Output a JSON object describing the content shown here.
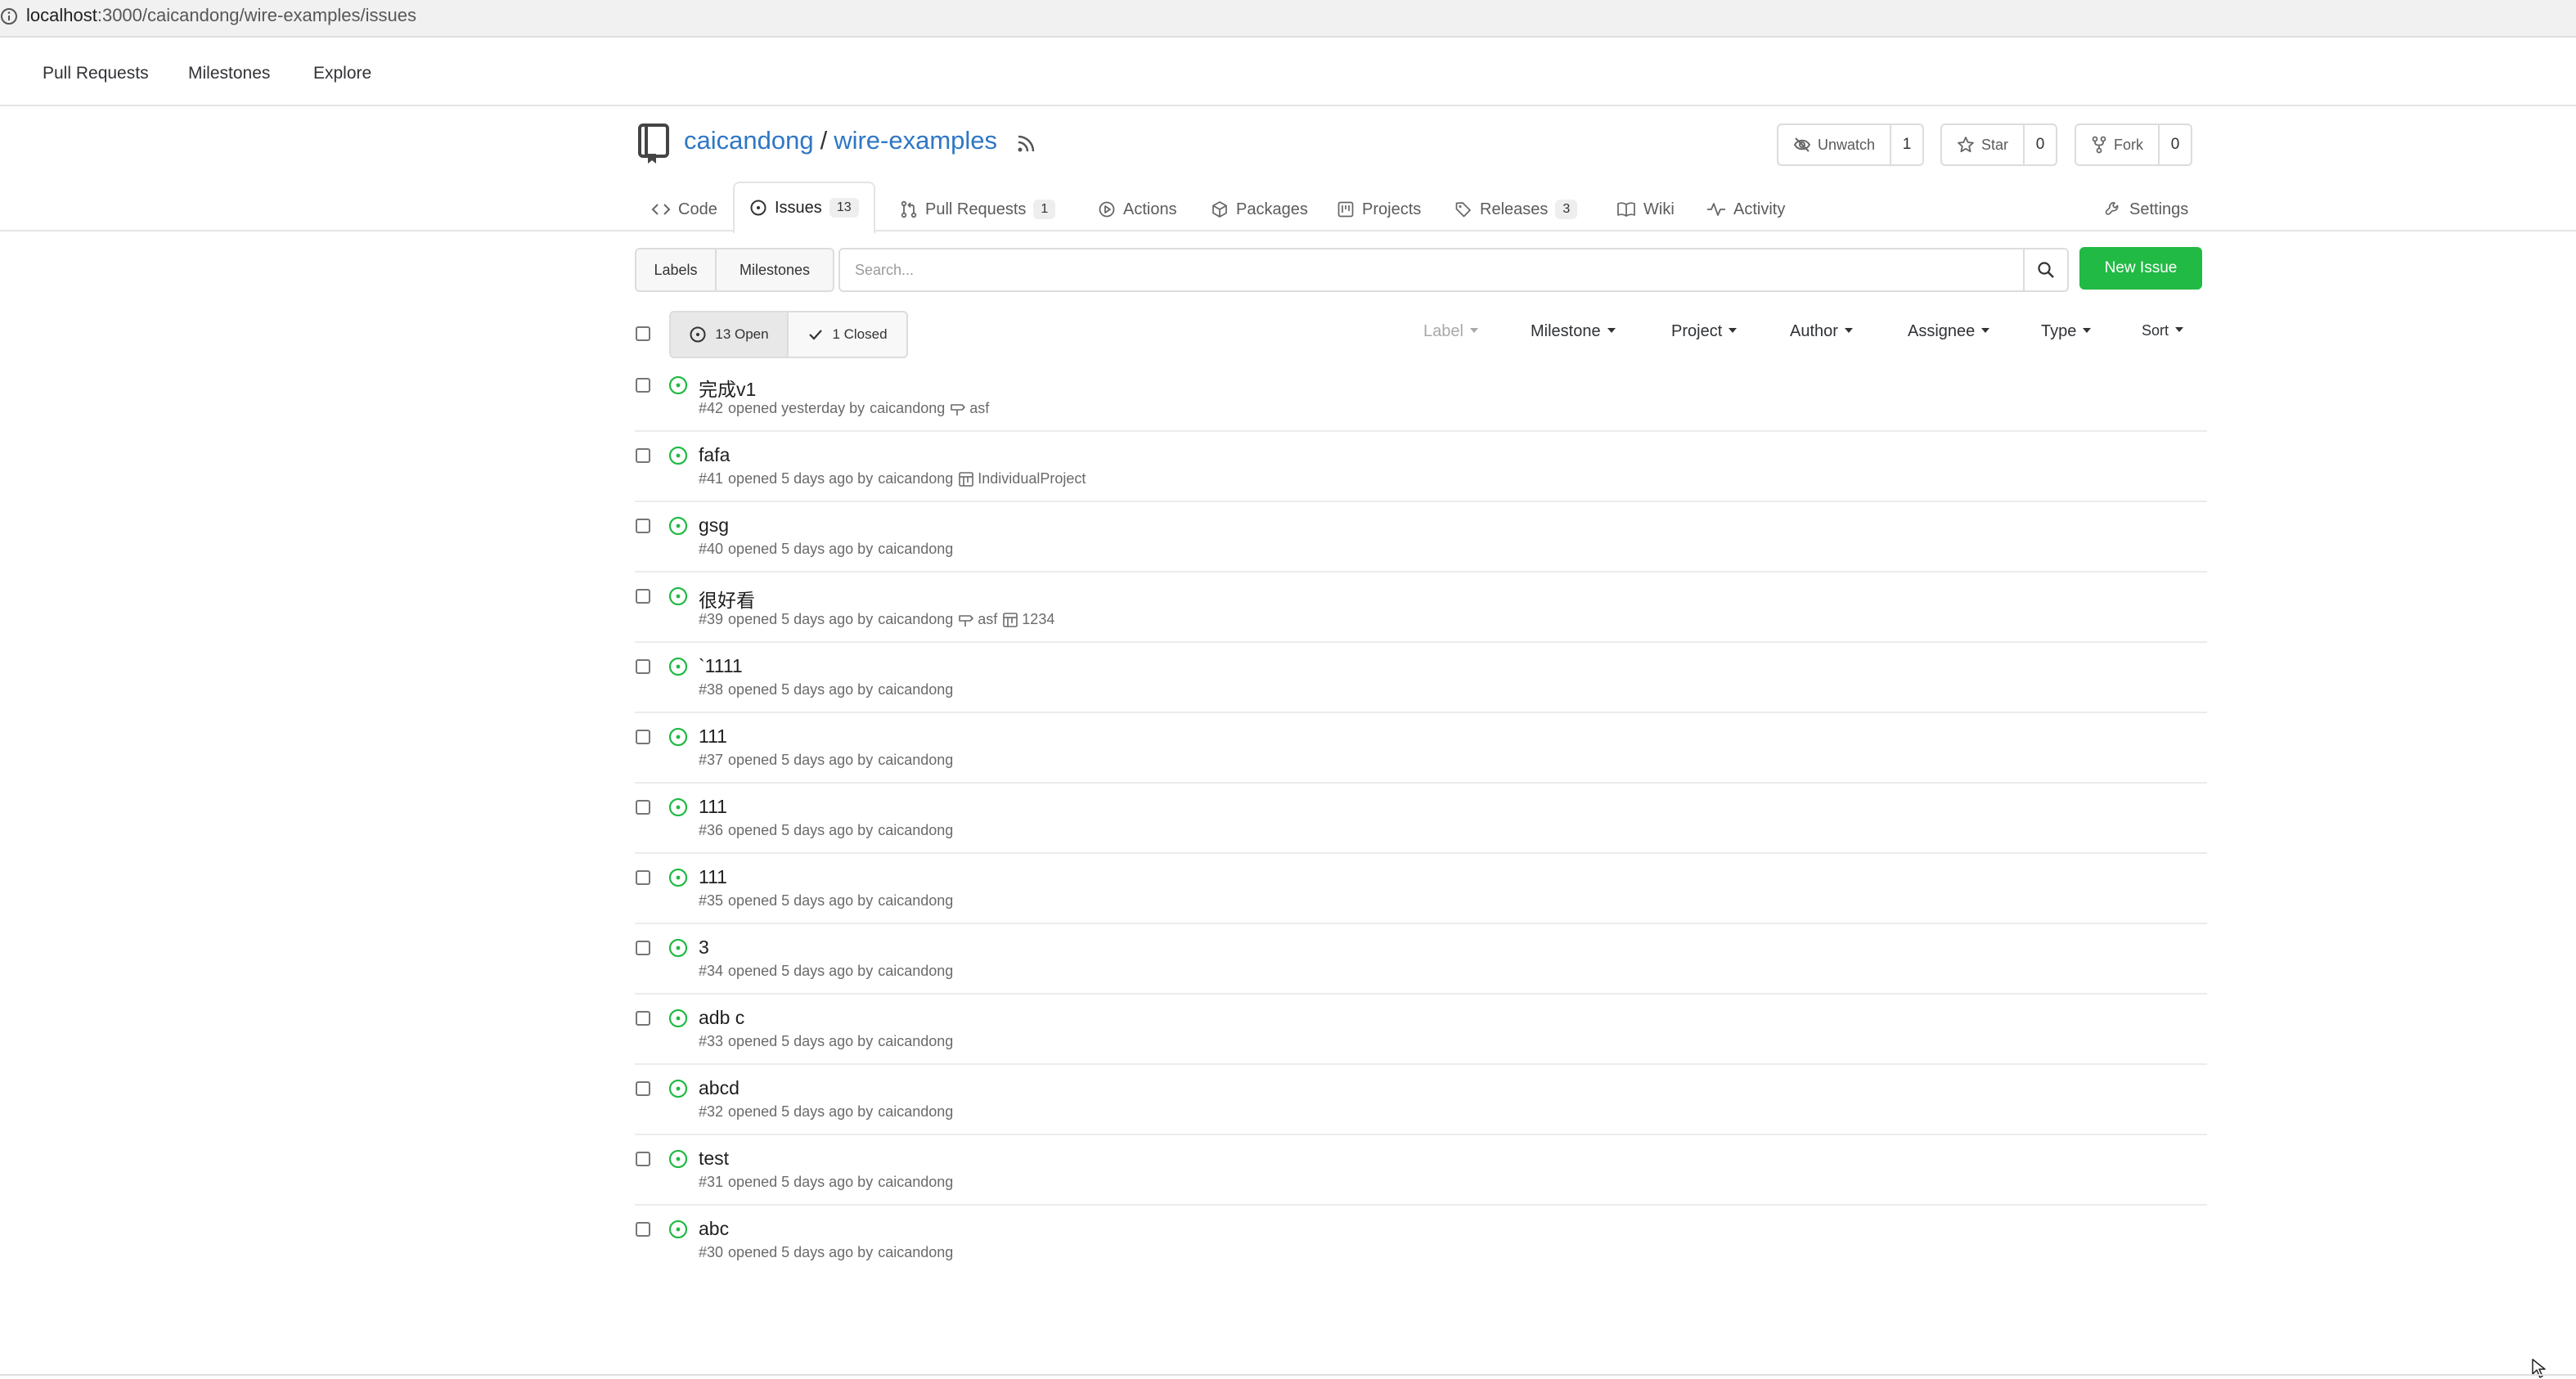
{
  "browser": {
    "url_host": "localhost",
    "url_path": ":3000/caicandong/wire-examples/issues"
  },
  "topnav": {
    "items": [
      "Pull Requests",
      "Milestones",
      "Explore"
    ]
  },
  "repo": {
    "owner": "caicandong",
    "separator": "/",
    "name": "wire-examples",
    "watch": {
      "label": "Unwatch",
      "count": "1"
    },
    "star": {
      "label": "Star",
      "count": "0"
    },
    "fork": {
      "label": "Fork",
      "count": "0"
    }
  },
  "tabs": {
    "code": "Code",
    "issues": {
      "label": "Issues",
      "count": "13"
    },
    "pulls": {
      "label": "Pull Requests",
      "count": "1"
    },
    "actions": "Actions",
    "packages": "Packages",
    "projects": "Projects",
    "releases": {
      "label": "Releases",
      "count": "3"
    },
    "wiki": "Wiki",
    "activity": "Activity",
    "settings": "Settings"
  },
  "filterbar": {
    "labels": "Labels",
    "milestones": "Milestones",
    "search_placeholder": "Search...",
    "new_issue": "New Issue"
  },
  "list_header": {
    "open": "13 Open",
    "closed": "1 Closed",
    "filters": [
      "Label",
      "Milestone",
      "Project",
      "Author",
      "Assignee",
      "Type",
      "Sort"
    ]
  },
  "issues": [
    {
      "title": "完成v1",
      "number": "#42",
      "opened": "opened yesterday by",
      "author": "caicandong",
      "milestone": "asf",
      "project": ""
    },
    {
      "title": "fafa",
      "number": "#41",
      "opened": "opened 5 days ago by",
      "author": "caicandong",
      "milestone": "",
      "project": "IndividualProject"
    },
    {
      "title": "gsg",
      "number": "#40",
      "opened": "opened 5 days ago by",
      "author": "caicandong",
      "milestone": "",
      "project": ""
    },
    {
      "title": "很好看",
      "number": "#39",
      "opened": "opened 5 days ago by",
      "author": "caicandong",
      "milestone": "asf",
      "project": "1234"
    },
    {
      "title": "`1111",
      "number": "#38",
      "opened": "opened 5 days ago by",
      "author": "caicandong",
      "milestone": "",
      "project": ""
    },
    {
      "title": "111",
      "number": "#37",
      "opened": "opened 5 days ago by",
      "author": "caicandong",
      "milestone": "",
      "project": ""
    },
    {
      "title": "111",
      "number": "#36",
      "opened": "opened 5 days ago by",
      "author": "caicandong",
      "milestone": "",
      "project": ""
    },
    {
      "title": "111",
      "number": "#35",
      "opened": "opened 5 days ago by",
      "author": "caicandong",
      "milestone": "",
      "project": ""
    },
    {
      "title": "3",
      "number": "#34",
      "opened": "opened 5 days ago by",
      "author": "caicandong",
      "milestone": "",
      "project": ""
    },
    {
      "title": "adb c",
      "number": "#33",
      "opened": "opened 5 days ago by",
      "author": "caicandong",
      "milestone": "",
      "project": ""
    },
    {
      "title": "abcd",
      "number": "#32",
      "opened": "opened 5 days ago by",
      "author": "caicandong",
      "milestone": "",
      "project": ""
    },
    {
      "title": "test",
      "number": "#31",
      "opened": "opened 5 days ago by",
      "author": "caicandong",
      "milestone": "",
      "project": ""
    },
    {
      "title": "abc",
      "number": "#30",
      "opened": "opened 5 days ago by",
      "author": "caicandong",
      "milestone": "",
      "project": ""
    }
  ],
  "colors": {
    "accent_green": "#21ba45",
    "link_blue": "#2f77c4",
    "open_icon": "#21ba45"
  }
}
